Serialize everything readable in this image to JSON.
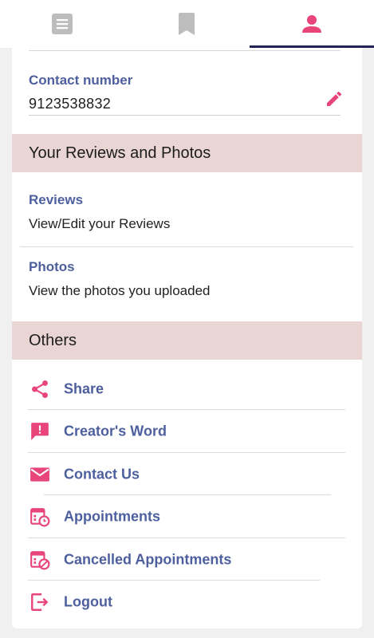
{
  "tabs": [
    {
      "name": "feed",
      "icon": "document-icon",
      "active": false
    },
    {
      "name": "saved",
      "icon": "bookmark-icon",
      "active": false
    },
    {
      "name": "profile",
      "icon": "person-icon",
      "active": true
    }
  ],
  "contact": {
    "label": "Contact number",
    "value": "9123538832"
  },
  "reviews_section": {
    "header": "Your Reviews and Photos",
    "items": [
      {
        "title": "Reviews",
        "subtitle": "View/Edit your Reviews"
      },
      {
        "title": "Photos",
        "subtitle": "View the photos you uploaded"
      }
    ]
  },
  "others_section": {
    "header": "Others",
    "items": [
      {
        "label": "Share",
        "icon": "share-icon"
      },
      {
        "label": "Creator's Word",
        "icon": "feedback-icon"
      },
      {
        "label": "Contact Us",
        "icon": "mail-icon"
      },
      {
        "label": "Appointments",
        "icon": "calendar-clock-icon"
      },
      {
        "label": "Cancelled Appointments",
        "icon": "calendar-cancel-icon"
      },
      {
        "label": "Logout",
        "icon": "logout-icon"
      }
    ]
  },
  "colors": {
    "accent": "#e8457a",
    "label_blue": "#4e5f9e",
    "section_bg": "#ead5d5",
    "tab_inactive": "#bdbdbd",
    "tab_indicator": "#1f2454"
  }
}
